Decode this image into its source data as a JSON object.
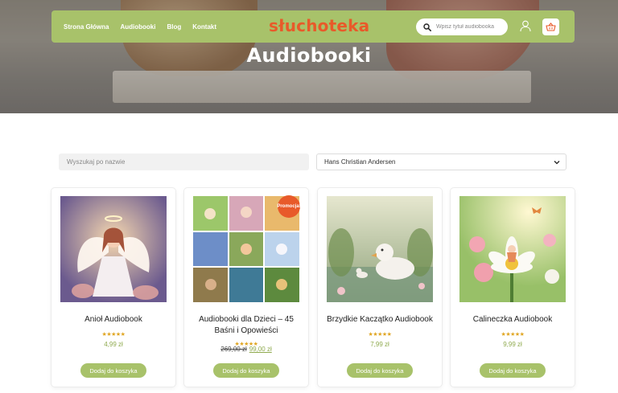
{
  "hero": {
    "title": "Audiobooki"
  },
  "nav": {
    "links": [
      "Strona Główna",
      "Audiobooki",
      "Blog",
      "Kontakt"
    ],
    "logo": "słuchoteka",
    "search_placeholder": "Wpisz tytuł audiobooka"
  },
  "filters": {
    "name_placeholder": "Wyszukaj po nazwie",
    "author_selected": "Hans Christian Andersen"
  },
  "products": [
    {
      "title": "Anioł Audiobook",
      "price": "4,99 zł",
      "button": "Dodaj do koszyka",
      "rating": 5
    },
    {
      "title": "Audiobooki dla Dzieci – 45 Baśni i Opowieści",
      "old_price": "269,00 zł",
      "price": "99,00 zł",
      "badge": "Promocja!",
      "button": "Dodaj do koszyka",
      "rating": 5
    },
    {
      "title": "Brzydkie Kaczątko Audiobook",
      "price": "7,99 zł",
      "button": "Dodaj do koszyka",
      "rating": 5
    },
    {
      "title": "Calineczka Audiobook",
      "price": "9,99 zł",
      "button": "Dodaj do koszyka",
      "rating": 5
    }
  ],
  "colors": {
    "accent": "#a8c26a",
    "brand": "#e85a2a",
    "star": "#e0a623"
  },
  "icons": {
    "search": "search-icon",
    "user": "user-icon",
    "cart": "basket-icon",
    "dropdown": "chevron-down-icon"
  }
}
